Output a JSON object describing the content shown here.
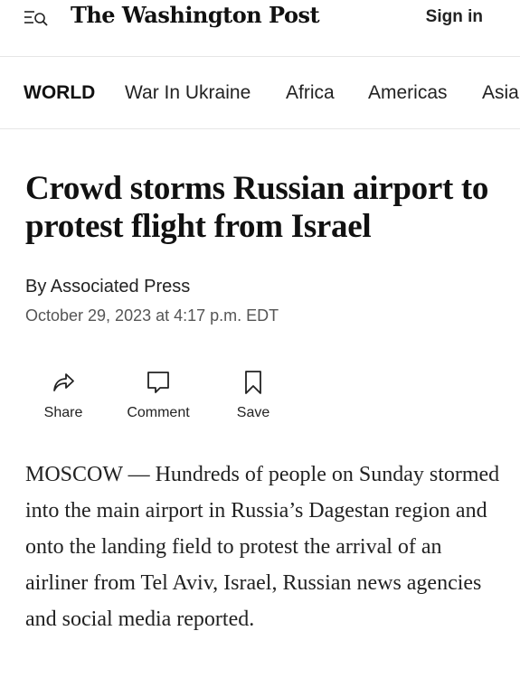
{
  "masthead": {
    "logo_text": "The Washington Post",
    "sign_in_label": "Sign in",
    "menu_icon": "menu-search-icon"
  },
  "nav": {
    "items": [
      {
        "label": "WORLD",
        "active": true
      },
      {
        "label": "War In Ukraine",
        "active": false
      },
      {
        "label": "Africa",
        "active": false
      },
      {
        "label": "Americas",
        "active": false
      },
      {
        "label": "Asia",
        "active": false
      }
    ]
  },
  "article": {
    "headline": "Crowd storms Russian airport to protest flight from Israel",
    "byline": "By Associated Press",
    "date": "October 29, 2023 at 4:17 p.m. EDT",
    "body": "MOSCOW — Hundreds of people on Sunday stormed into the main airport in Russia’s Dagestan region and onto the landing field to protest the arrival of an airliner from Tel Aviv, Israel, Russian news agencies and social media reported."
  },
  "actions": {
    "share": {
      "label": "Share",
      "icon": "share-icon"
    },
    "comment": {
      "label": "Comment",
      "icon": "comment-icon"
    },
    "save": {
      "label": "Save",
      "icon": "bookmark-icon"
    }
  }
}
